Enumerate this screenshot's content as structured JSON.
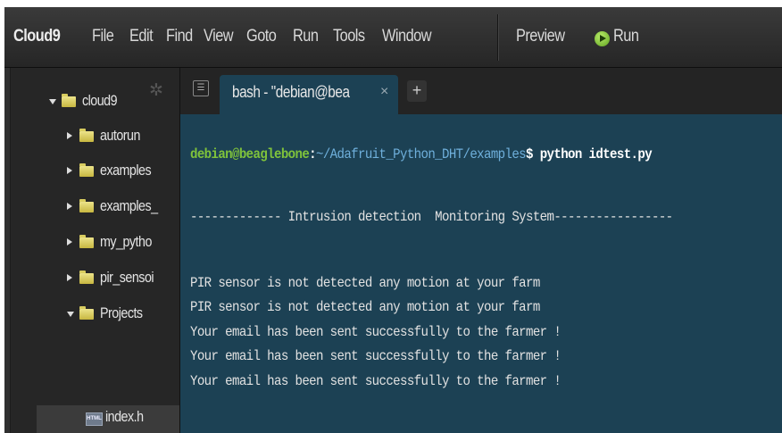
{
  "menubar": {
    "brand": "Cloud9",
    "items": [
      "File",
      "Edit",
      "Find",
      "View",
      "Goto",
      "Run",
      "Tools",
      "Window"
    ],
    "preview": "Preview",
    "run": "Run"
  },
  "sidebar": {
    "root": "cloud9",
    "items": [
      {
        "label": "autorun",
        "type": "folder",
        "open": false
      },
      {
        "label": "examples",
        "type": "folder",
        "open": false
      },
      {
        "label": "examples_",
        "type": "folder",
        "open": false
      },
      {
        "label": "my_pytho",
        "type": "folder",
        "open": false
      },
      {
        "label": "pir_sensoi",
        "type": "folder",
        "open": false
      },
      {
        "label": "Projects",
        "type": "folder",
        "open": true
      },
      {
        "label": "index.h",
        "type": "html-file",
        "icon_text": "HTML"
      }
    ]
  },
  "tabs": [
    {
      "label": "bash - \"debian@bea",
      "close": "×"
    }
  ],
  "add_tab": "+",
  "terminal": {
    "prompt_user": "debian@beaglebone",
    "prompt_sep": ":",
    "prompt_path": "~/Adafruit_Python_DHT/examples",
    "prompt_dollar": "$",
    "command": " python idtest.py",
    "lines": [
      "------------- Intrusion detection  Monitoring System-----------------",
      "PIR sensor is not detected any motion at your farm",
      "PIR sensor is not detected any motion at your farm",
      "Your email has been sent successfully to the farmer !",
      "Your email has been sent successfully to the farmer !",
      "Your email has been sent successfully to the farmer !"
    ]
  },
  "colors": {
    "terminal_bg": "#1c4154",
    "prompt_user": "#7fc33b",
    "prompt_path": "#6fb0dc",
    "folder": "#e0d26a"
  }
}
